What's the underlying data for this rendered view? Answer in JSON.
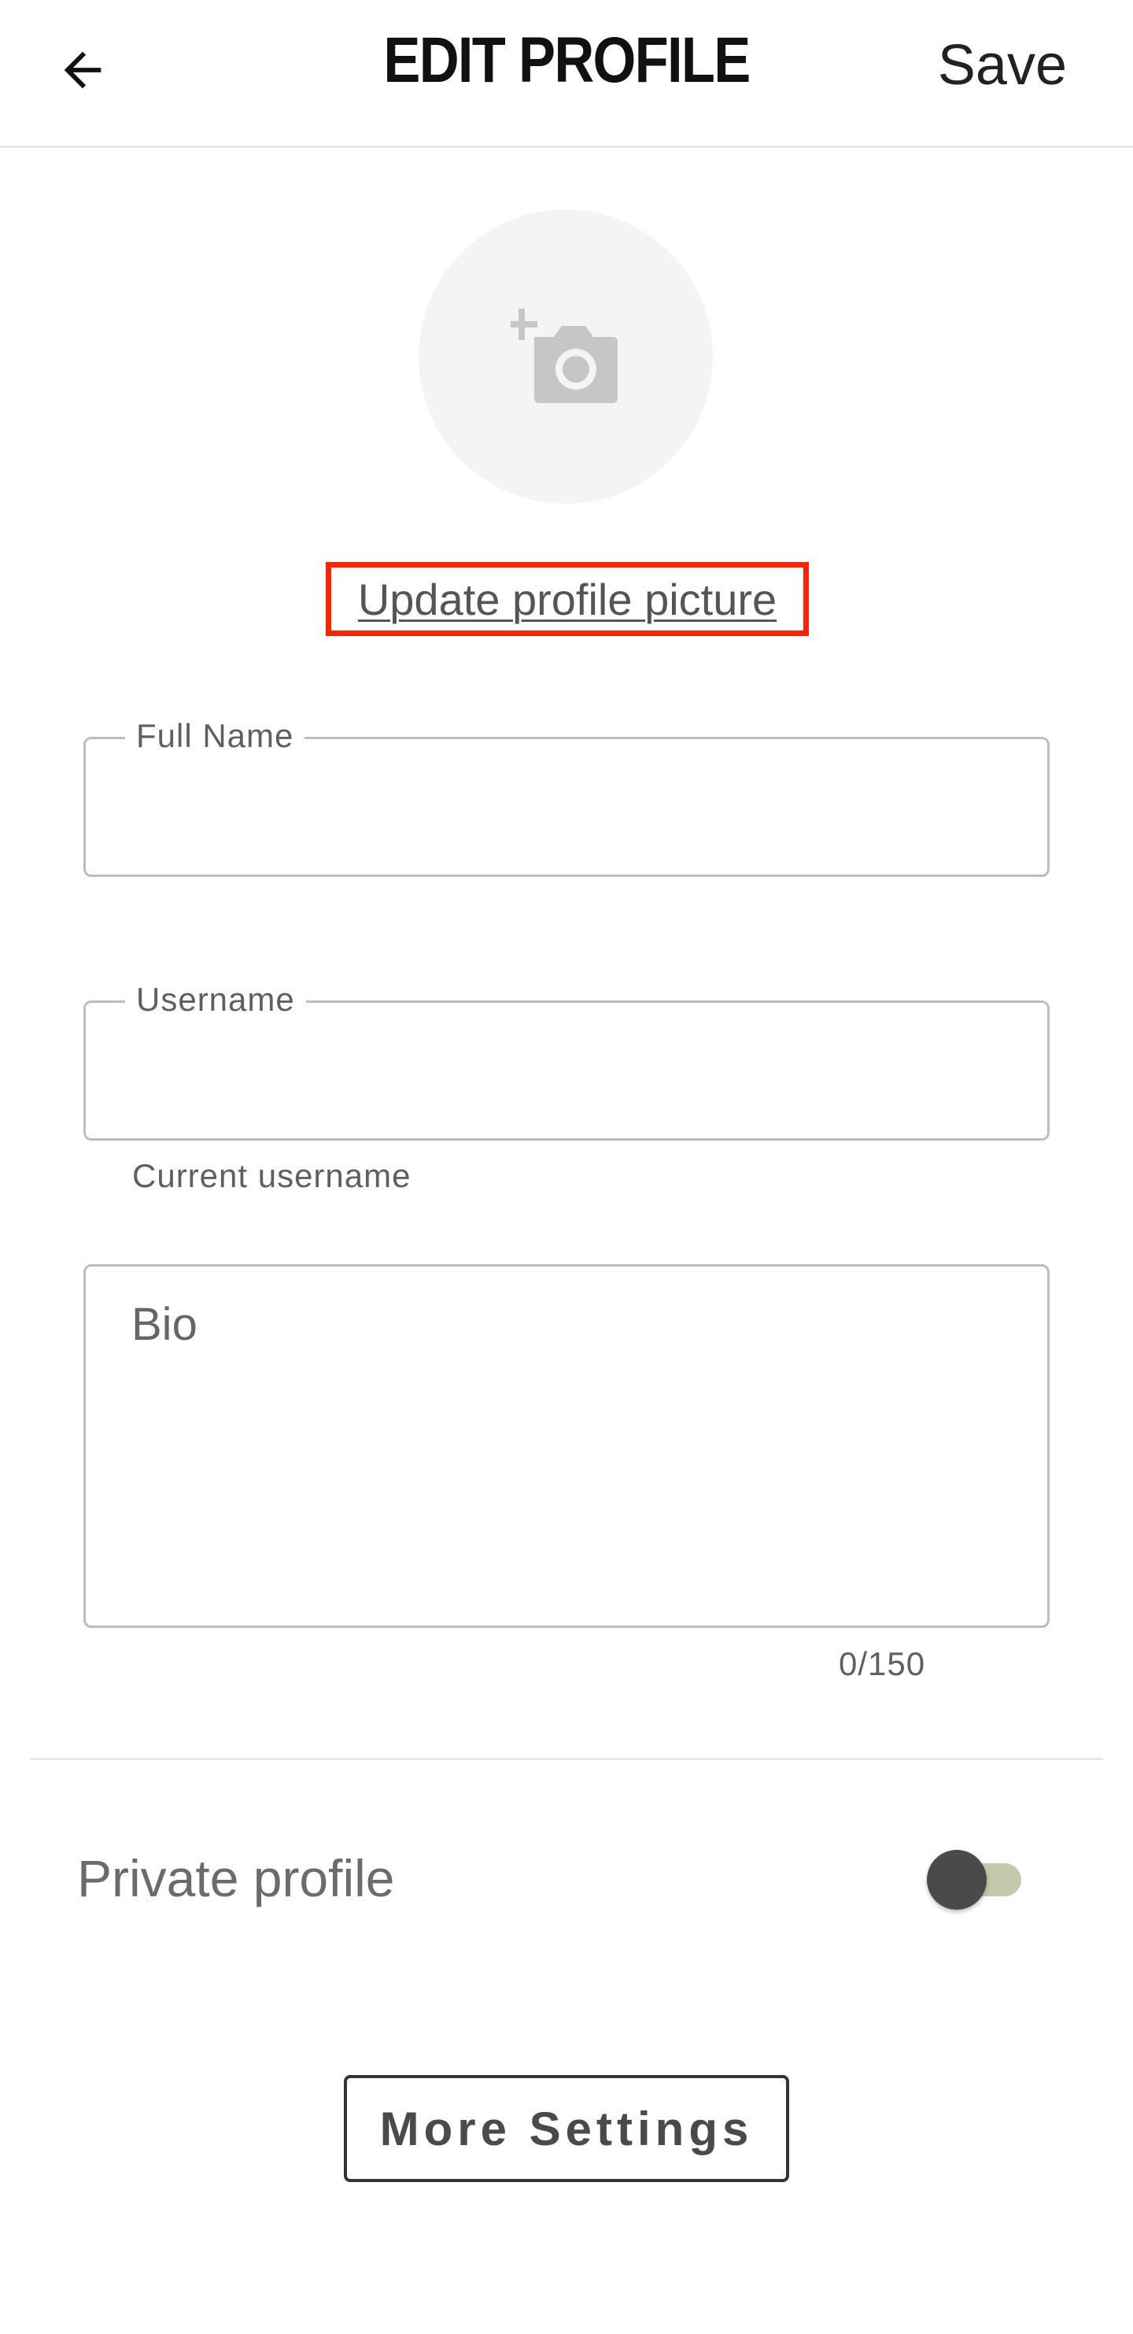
{
  "header": {
    "title": "EDIT PROFILE",
    "save_label": "Save",
    "back_icon": "arrow-left-icon"
  },
  "avatar": {
    "icon": "add-photo-camera-icon",
    "update_label": "Update profile picture",
    "highlight_color": "#ff2200"
  },
  "form": {
    "full_name": {
      "label": "Full Name",
      "value": ""
    },
    "username": {
      "label": "Username",
      "value": "",
      "helper": "Current username"
    },
    "bio": {
      "placeholder": "Bio",
      "value": "",
      "counter": "0/150"
    }
  },
  "privacy": {
    "label": "Private profile",
    "enabled": false
  },
  "more_settings_label": "More Settings"
}
